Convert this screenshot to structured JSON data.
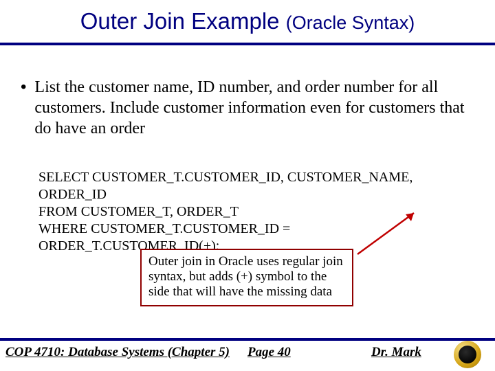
{
  "title": {
    "main": "Outer Join Example ",
    "sub": "(Oracle Syntax)"
  },
  "bullet": "List the customer name, ID number, and order number for all customers. Include customer information even for customers that do have an order",
  "sql": {
    "line1": "SELECT CUSTOMER_T.CUSTOMER_ID, CUSTOMER_NAME, ORDER_ID",
    "line2": "FROM CUSTOMER_T,  ORDER_T",
    "line3": "WHERE CUSTOMER_T.CUSTOMER_ID = ORDER_T.CUSTOMER_ID(+);"
  },
  "callout": "Outer join in Oracle uses regular join syntax, but adds (+) symbol to the side that will have the missing data",
  "footer": {
    "left": "COP 4710: Database Systems  (Chapter 5)",
    "center": "Page 40",
    "right": "Dr. Mark"
  }
}
